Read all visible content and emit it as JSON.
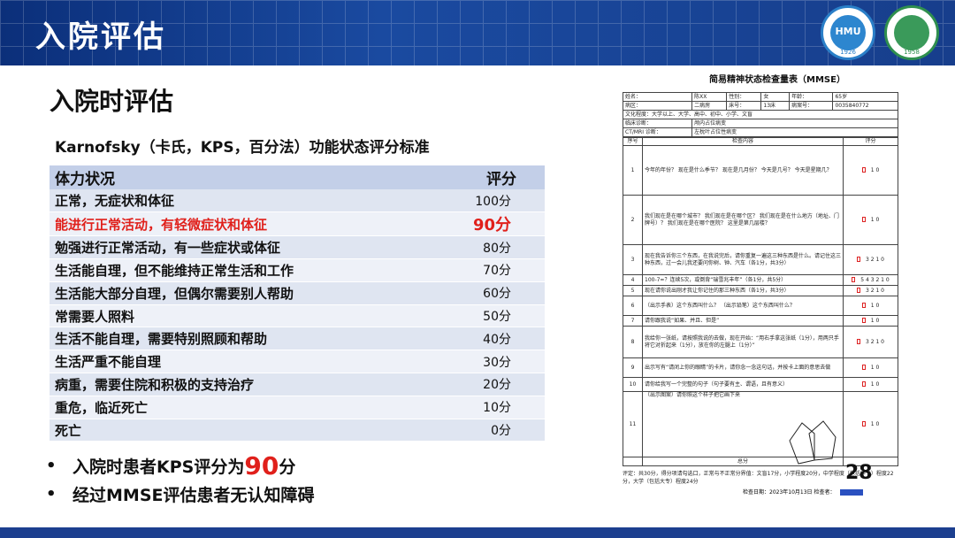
{
  "header": {
    "title": "入院评估",
    "logo1_text": "HMU",
    "logo2_text": "1958",
    "logo1_year": "1926"
  },
  "subtitle": "入院时评估",
  "kps": {
    "caption": "Karnofsky（卡氏，KPS，百分法）功能状态评分标准",
    "col_status": "体力状况",
    "col_score": "评分",
    "rows": [
      {
        "status": "正常，无症状和体征",
        "score": "100分"
      },
      {
        "status": "能进行正常活动，有轻微症状和体征",
        "score": "90分"
      },
      {
        "status": "勉强进行正常活动，有一些症状或体征",
        "score": "80分"
      },
      {
        "status": "生活能自理，但不能维持正常生活和工作",
        "score": "70分"
      },
      {
        "status": "生活能大部分自理，但偶尔需要别人帮助",
        "score": "60分"
      },
      {
        "status": "常需要人照料",
        "score": "50分"
      },
      {
        "status": "生活不能自理，需要特别照顾和帮助",
        "score": "40分"
      },
      {
        "status": "生活严重不能自理",
        "score": "30分"
      },
      {
        "status": "病重，需要住院和积极的支持治疗",
        "score": "20分"
      },
      {
        "status": "重危，临近死亡",
        "score": "10分"
      },
      {
        "status": "死亡",
        "score": "0分"
      }
    ]
  },
  "bullets": {
    "b1_prefix": "入院时患者KPS评分为",
    "b1_num": "90",
    "b1_suffix": "分",
    "b2": "经过MMSE评估患者无认知障碍"
  },
  "mmse": {
    "title": "简易精神状态检查量表（MMSE）",
    "name_label": "姓名：",
    "name_value": "陈XX",
    "sex_label": "性别：",
    "sex_value": "女",
    "age_label": "年龄：",
    "age_value": "65岁",
    "ward_label": "病区：",
    "ward_value": "二病房",
    "bed_label": "床号：",
    "bed_value": "13床",
    "case_label": "病案号：",
    "case_value": "0035840772",
    "edu": "文化程度：大学以上、大学、高中、初中、小学、文盲",
    "diag_label": "临床诊断：",
    "diag_value": "颅内占位病变",
    "ct_label": "CT/MRI 诊断：",
    "ct_value": "左枕叶占位性病变",
    "col_no": "序号",
    "col_content": "检查内容",
    "col_score": "评分",
    "items": [
      {
        "no": "1",
        "content": "今年的年份？ 现在是什么季节？ 现在是几月份？ 今天是几号？ 今天是星期几？",
        "score": "1  0"
      },
      {
        "no": "2",
        "content": "我们现在是在哪个城市？ 我们现在是在哪个区？ 我们现在是在什么地方（地址、门牌号）？ 我们现在是在哪个医院？ 这里是第几层楼？",
        "score": "1  0"
      },
      {
        "no": "3",
        "content": "现在我告诉你三个东西，在我说完后，请你重复一遍这三种东西是什么。请记住这三种东西，过一会儿我还要问你树、钟、汽车（各1分，共3分）",
        "score": "3  2  1  0"
      },
      {
        "no": "4",
        "content": "100-7=？连续5次，或倒背“瑞雪兆丰年”（各1分，共5分）",
        "score": "5 4 3 2 1 0"
      },
      {
        "no": "5",
        "content": "现在请你说出刚才我让你记住的那三种东西（各1分，共3分）",
        "score": "3  2  1  0"
      },
      {
        "no": "6",
        "content": "（出示手表）这个东西叫什么？ （出示铅笔）这个东西叫什么？",
        "score": "1  0"
      },
      {
        "no": "7",
        "content": "请你跟我说“如果、并且、但是”",
        "score": "1  0"
      },
      {
        "no": "8",
        "content": "我给你一张纸，请按照我说的去做，现在开始：“用右手拿这张纸（1分），用两只手将它对折起来（1分），放在你的左腿上（1分）”",
        "score": "3  2  1  0"
      },
      {
        "no": "9",
        "content": "出示写有“请闭上你的眼睛”的卡片，请你念一念这句话，并按卡上面的意思去做",
        "score": "1  0"
      },
      {
        "no": "10",
        "content": "请你给我写一个完整的句子（句子要有主、谓语，且有意义）",
        "score": "1  0"
      },
      {
        "no": "11",
        "content": "（出示图案）请你照这个样子把它画下来",
        "score": "1  0"
      }
    ],
    "total_label": "总分",
    "footnote": "评定：共30分，得分项请勾选口，正常与不正常分界值：文盲17分，小学程度20分，中学程度（包括中专）程度22分，大学（包括大专）程度24分",
    "date": "检查日期：2023年10月13日",
    "examiner": "检查者："
  },
  "page_number": "28"
}
